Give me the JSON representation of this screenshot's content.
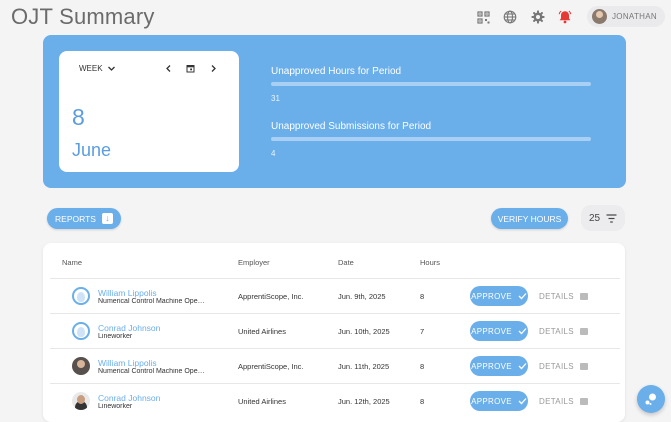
{
  "header": {
    "title": "OJT Summary",
    "user_name": "JONATHAN",
    "icons": [
      "qr-code-icon",
      "globe-icon",
      "gear-icon",
      "bell-icon"
    ],
    "bell_color": "#e53935"
  },
  "period": {
    "range_label": "WEEK",
    "day": "8",
    "month": "June"
  },
  "stats": [
    {
      "label": "Unapproved Hours for Period",
      "value": "31",
      "fill": 0
    },
    {
      "label": "Unapproved Submissions for Period",
      "value": "4",
      "fill": 0
    }
  ],
  "toolbar": {
    "reports_label": "REPORTS",
    "verify_label": "VERIFY HOURS",
    "per_page": "25"
  },
  "table": {
    "columns": [
      "Name",
      "Employer",
      "Date",
      "Hours"
    ],
    "approve_label": "APPROVE",
    "details_label": "DETAILS",
    "rows": [
      {
        "name": "William Lippolis",
        "role": "Numerical Control Machine Operator",
        "employer": "ApprentiScope, Inc.",
        "date": "Jun. 9th, 2025",
        "hours": "8",
        "avatar": "generic"
      },
      {
        "name": "Conrad Johnson",
        "role": "Lineworker",
        "employer": "United Airlines",
        "date": "Jun. 10th, 2025",
        "hours": "7",
        "avatar": "generic"
      },
      {
        "name": "William Lippolis",
        "role": "Numerical Control Machine Operator",
        "employer": "ApprentiScope, Inc.",
        "date": "Jun. 11th, 2025",
        "hours": "8",
        "avatar": "photo1"
      },
      {
        "name": "Conrad Johnson",
        "role": "Lineworker",
        "employer": "United Airlines",
        "date": "Jun. 12th, 2025",
        "hours": "8",
        "avatar": "photo2"
      }
    ]
  },
  "colors": {
    "accent": "#6aaeea",
    "background": "#f4f4f5"
  }
}
